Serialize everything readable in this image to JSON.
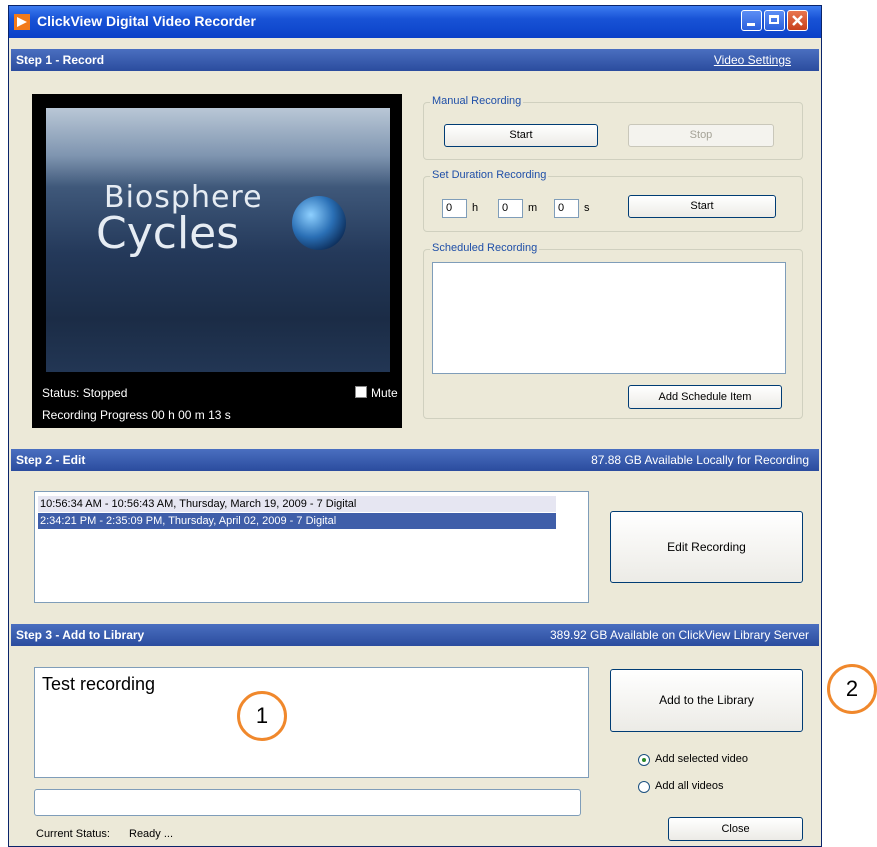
{
  "window": {
    "title": "ClickView Digital Video Recorder"
  },
  "step1": {
    "header": "Step 1 - Record",
    "video_settings_link": "Video Settings",
    "video": {
      "title_line1": "Biosphere",
      "title_line2": "Cycles",
      "status": "Status: Stopped",
      "mute_label": "Mute",
      "progress": "Recording Progress 00 h 00 m 13 s"
    },
    "manual": {
      "legend": "Manual Recording",
      "start": "Start",
      "stop": "Stop"
    },
    "duration": {
      "legend": "Set Duration Recording",
      "hours": "0",
      "minutes": "0",
      "seconds": "0",
      "h_unit": "h",
      "m_unit": "m",
      "s_unit": "s",
      "start": "Start"
    },
    "scheduled": {
      "legend": "Scheduled Recording",
      "add_button": "Add Schedule Item"
    }
  },
  "step2": {
    "header": "Step 2 - Edit",
    "available": "87.88 GB Available Locally for Recording",
    "recordings": [
      "10:56:34 AM - 10:56:43 AM, Thursday, March 19, 2009 - 7 Digital",
      "2:34:21 PM - 2:35:09 PM, Thursday, April 02, 2009 - 7 Digital"
    ],
    "edit_button": "Edit Recording"
  },
  "step3": {
    "header": "Step 3 - Add to Library",
    "available": "389.92 GB Available on ClickView Library Server",
    "description": "Test recording",
    "add_button": "Add to the Library",
    "radio_selected": "Add selected video",
    "radio_all": "Add all videos",
    "status_label": "Current Status:",
    "status_value": "Ready ...",
    "close_button": "Close"
  },
  "callouts": {
    "one": "1",
    "two": "2"
  },
  "colors": {
    "titlebar": "#1853d6",
    "section_header": "#2b4c9e",
    "window_bg": "#ece9d8",
    "callout_ring": "#f0882c",
    "selection": "#3f5ea9"
  }
}
